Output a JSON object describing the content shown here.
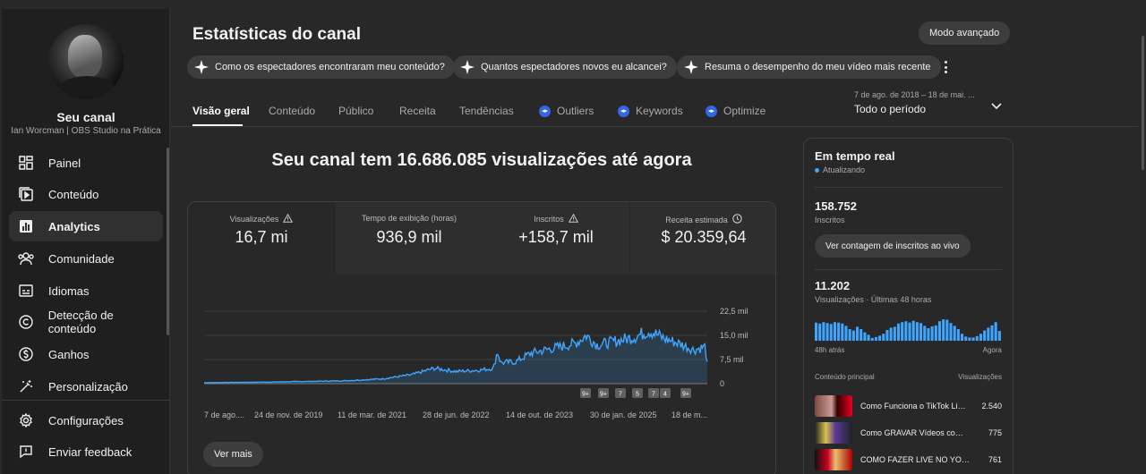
{
  "channel": {
    "label": "Seu canal",
    "name": "Ian Worcman | OBS Studio na Prática"
  },
  "sidebar": {
    "items": [
      {
        "label": "Painel",
        "icon": "dashboard-icon"
      },
      {
        "label": "Conteúdo",
        "icon": "content-icon"
      },
      {
        "label": "Analytics",
        "icon": "analytics-icon",
        "active": true
      },
      {
        "label": "Comunidade",
        "icon": "community-icon"
      },
      {
        "label": "Idiomas",
        "icon": "subtitles-icon"
      },
      {
        "label": "Detecção de conteúdo",
        "icon": "copyright-icon"
      },
      {
        "label": "Ganhos",
        "icon": "dollar-icon"
      },
      {
        "label": "Personalização",
        "icon": "magic-wand-icon"
      }
    ],
    "footer": [
      {
        "label": "Configurações",
        "icon": "gear-icon"
      },
      {
        "label": "Enviar feedback",
        "icon": "feedback-icon"
      }
    ]
  },
  "header": {
    "title": "Estatísticas do canal",
    "advanced_mode": "Modo avançado",
    "chips": [
      "Como os espectadores encontraram meu conteúdo?",
      "Quantos espectadores novos eu alcancei?",
      "Resuma o desempenho do meu vídeo mais recente"
    ]
  },
  "tabs": [
    {
      "label": "Visão geral",
      "active": true
    },
    {
      "label": "Conteúdo"
    },
    {
      "label": "Público"
    },
    {
      "label": "Receita"
    },
    {
      "label": "Tendências"
    },
    {
      "label": "Outliers",
      "badge": "vidiq"
    },
    {
      "label": "Keywords",
      "badge": "vidiq"
    },
    {
      "label": "Optimize",
      "badge": "vidiq"
    }
  ],
  "period": {
    "range": "7 de ago. de 2018 – 18 de mai. ...",
    "value": "Todo o período"
  },
  "headline": "Seu canal tem 16.686.085 visualizações até agora",
  "metrics": [
    {
      "title": "Visualizações",
      "value": "16,7 mi",
      "icon": "warning-icon"
    },
    {
      "title": "Tempo de exibição (horas)",
      "value": "936,9 mil"
    },
    {
      "title": "Inscritos",
      "value": "+158,7 mil",
      "icon": "warning-icon"
    },
    {
      "title": "Receita estimada",
      "value": "$ 20.359,64",
      "icon": "clock-icon"
    }
  ],
  "chart_data": {
    "type": "area",
    "x_ticks": [
      "7 de ago....",
      "24 de nov. de 2019",
      "11 de mar. de 2021",
      "28 de jun. de 2022",
      "14 de out. de 2023",
      "30 de jan. de 2025",
      "18 de m..."
    ],
    "y_ticks": [
      "22,5 mil",
      "15,0 mil",
      "7,5 mil",
      "0"
    ],
    "ylim": [
      0,
      22500
    ],
    "x_years": [
      2018.6,
      2019.0,
      2019.5,
      2020.0,
      2020.5,
      2021.0,
      2021.4,
      2021.7,
      2022.0,
      2022.3,
      2022.5,
      2022.55,
      2022.6,
      2022.8,
      2023.0,
      2023.3,
      2023.6,
      2023.75,
      2023.9,
      2024.1,
      2024.4,
      2024.6,
      2024.8,
      2025.0,
      2025.2,
      2025.35,
      2025.38
    ],
    "y_values": [
      300,
      400,
      500,
      700,
      900,
      1500,
      2800,
      4800,
      3800,
      4200,
      4800,
      10000,
      6500,
      6800,
      9500,
      11000,
      12500,
      15000,
      12000,
      13000,
      14500,
      16500,
      14000,
      12500,
      10500,
      11500,
      6000
    ],
    "color": "#3ea6ff",
    "markers": [
      "9+",
      "9+",
      "7",
      "5",
      "7",
      "4",
      "9+"
    ]
  },
  "see_more": "Ver mais",
  "realtime": {
    "title": "Em tempo real",
    "status": "Atualizando",
    "subscribers": "158.752",
    "subscribers_label": "Inscritos",
    "live_button": "Ver contagem de inscritos ao vivo",
    "views": "11.202",
    "views_label": "Visualizações · Últimas 48 horas",
    "axis_start": "48h atrás",
    "axis_end": "Agora",
    "bar_values": [
      0.78,
      0.74,
      0.8,
      0.76,
      0.72,
      0.8,
      0.78,
      0.74,
      0.64,
      0.5,
      0.44,
      0.6,
      0.5,
      0.36,
      0.26,
      0.12,
      0.16,
      0.22,
      0.3,
      0.46,
      0.56,
      0.6,
      0.74,
      0.8,
      0.84,
      0.78,
      0.86,
      0.8,
      0.76,
      0.64,
      0.54,
      0.62,
      0.66,
      0.84,
      0.92,
      0.9,
      0.76,
      0.64,
      0.5,
      0.3,
      0.18,
      0.14,
      0.14,
      0.2,
      0.3,
      0.44,
      0.56,
      0.66,
      0.8,
      0.42
    ],
    "top_content_label": "Conteúdo principal",
    "top_views_label": "Visualizações",
    "top_content": [
      {
        "title": "Como Funciona o TikTok Live Studio?",
        "views": "2.540"
      },
      {
        "title": "Como GRAVAR Vídeos com OBS Studio",
        "views": "775"
      },
      {
        "title": "COMO FAZER LIVE NO YOUTUBE",
        "views": "761"
      }
    ]
  }
}
